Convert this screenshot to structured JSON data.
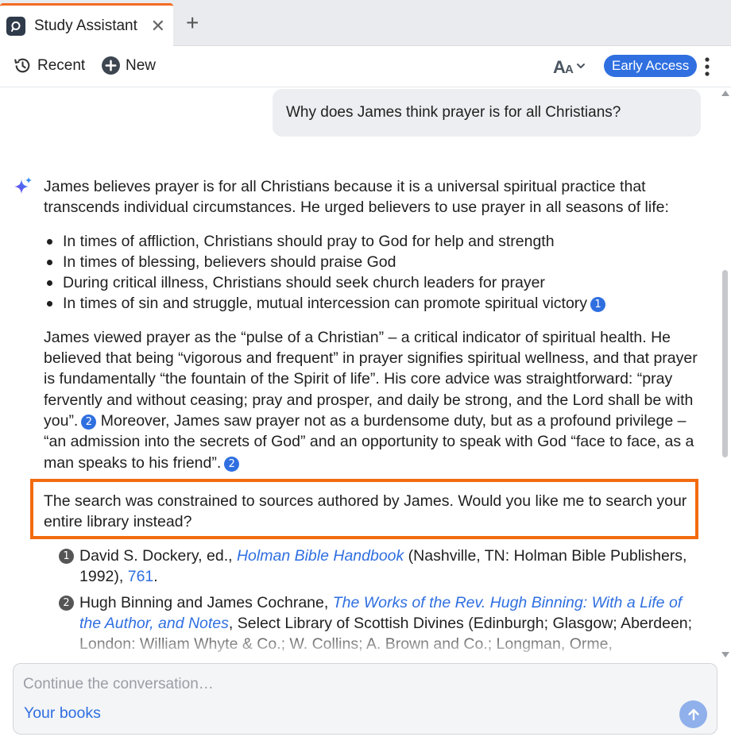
{
  "tabs": [
    {
      "label": "Study Assistant",
      "active": true
    }
  ],
  "toolbar": {
    "recent_label": "Recent",
    "new_label": "New",
    "early_access_label": "Early Access"
  },
  "conversation": {
    "user_question": "Why does James think prayer is for all Christians?",
    "answer_intro": "James believes prayer is for all Christians because it is a universal spiritual practice that transcends individual circumstances. He urged believers to use prayer in all seasons of life:",
    "bullets": [
      "In times of affliction, Christians should pray to God for help and strength",
      "In times of blessing, believers should praise God",
      "During critical illness, Christians should seek church leaders for prayer",
      "In times of sin and struggle, mutual intercession can promote spiritual victory"
    ],
    "bullet_citation": "1",
    "paragraph_part1": "James viewed prayer as the “pulse of a Christian” – a critical indicator of spiritual health. He believed that being “vigorous and frequent” in prayer signifies spiritual wellness, and that prayer is fundamentally “the fountain of the Spirit of life”. His core advice was straightforward: “pray fervently and without ceasing; pray and prosper, and daily be strong, and the Lord shall be with you”.",
    "paragraph_cite1": "2",
    "paragraph_part2": " Moreover, James saw prayer not as a burdensome duty, but as a profound privilege – “an admission into the secrets of God” and an opportunity to speak with God “face to face, as a man speaks to his friend”.",
    "paragraph_cite2": "2",
    "notice": "The search was constrained to sources authored by James. Would you like me to search your entire library instead?",
    "references": [
      {
        "num": "1",
        "prefix": "David S. Dockery, ed., ",
        "title": "Holman Bible Handbook",
        "middle": " (Nashville, TN: Holman Bible Publishers, 1992), ",
        "page": "761",
        "suffix": "."
      },
      {
        "num": "2",
        "prefix": "Hugh Binning and James Cochrane, ",
        "title": "The Works of the Rev. Hugh Binning: With a Life of the Author, and Notes",
        "middle": ", Select Library of Scottish Divines (Edinburgh; Glasgow; Aberdeen; London: William Whyte & Co.; W. Collins; A. Brown and Co.; Longman, Orme,",
        "page": "",
        "suffix": ""
      }
    ]
  },
  "composer": {
    "placeholder": "Continue the conversation…",
    "scope_label": "Your books"
  },
  "colors": {
    "accent": "#2f6fe0",
    "tab_indicator": "#f36b21",
    "notice_border": "#f36b0f"
  },
  "icons": {
    "tab": "study-assistant-logo-icon",
    "recent": "history-icon",
    "new": "plus-circle-icon",
    "font_size": "font-size-icon",
    "more": "more-vertical-icon",
    "answer": "sparkle-icon",
    "send": "arrow-up-icon"
  }
}
